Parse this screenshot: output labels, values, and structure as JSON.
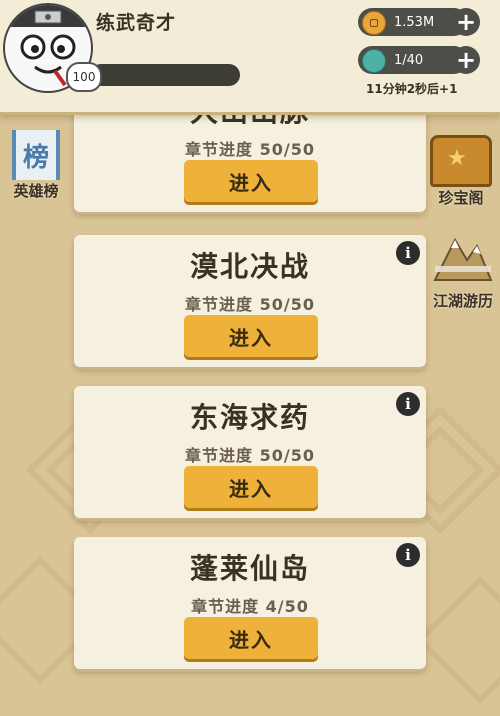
{
  "player": {
    "name": "练武奇才",
    "level": "100",
    "xp_fraction": 0.0
  },
  "resources": {
    "coins": "1.53M",
    "energy": "1/40",
    "timer": "11分钟2秒后+1"
  },
  "side": {
    "rank_icon_text": "榜",
    "rank_label": "英雄榜",
    "treasure_label": "珍宝阁",
    "travel_label": "江湖游历"
  },
  "chapters": [
    {
      "title": "大山山脉",
      "progress": "章节进度 50/50",
      "button": "进入"
    },
    {
      "title": "漠北决战",
      "progress": "章节进度 50/50",
      "button": "进入"
    },
    {
      "title": "东海求药",
      "progress": "章节进度 50/50",
      "button": "进入"
    },
    {
      "title": "蓬莱仙岛",
      "progress": "章节进度 4/50",
      "button": "进入"
    }
  ],
  "colors": {
    "background": "#d9c495",
    "card": "#f6f0e0",
    "button": "#eeb23a",
    "header": "#f3ecd6"
  }
}
